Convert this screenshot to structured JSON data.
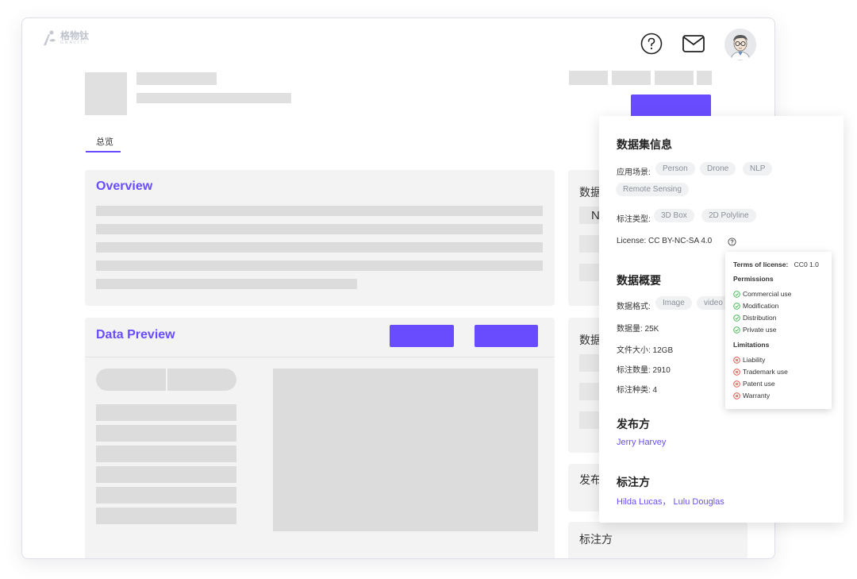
{
  "brand": {
    "name": "格物钛",
    "sub": "GRAVITI"
  },
  "tabs": [
    {
      "label": "总览"
    }
  ],
  "overview": {
    "title": "Overview"
  },
  "preview": {
    "title": "Data Preview"
  },
  "right_col": {
    "sec1": "数据",
    "letter": "N",
    "sec2": "数据",
    "sec3": "发布",
    "sec4": "标注方"
  },
  "dataset_info": {
    "title": "数据集信息",
    "scenario_label": "应用场景:",
    "scenarios": [
      "Person",
      "Drone",
      "NLP",
      "Remote Sensing"
    ],
    "annotation_label": "标注类型:",
    "annotation_types": [
      "3D Box",
      "2D Polyline"
    ],
    "license": "License: CC BY-NC-SA 4.0"
  },
  "summary": {
    "title": "数据概要",
    "format_label": "数据格式:",
    "formats": [
      "Image",
      "video"
    ],
    "count": "数据量: 25K",
    "size": "文件大小: 12GB",
    "ann_count": "标注数量: 2910",
    "ann_kinds": "标注种类: 4"
  },
  "publisher": {
    "title": "发布方",
    "name": "Jerry Harvey"
  },
  "annotator": {
    "title": "标注方",
    "names": "Hilda Lucas，  Lulu Douglas"
  },
  "license_tooltip": {
    "terms_label": "Terms of license:",
    "terms_value": "CC0 1.0",
    "permissions_title": "Permissions",
    "permissions": [
      "Commercial use",
      "Modification",
      "Distribution",
      "Private use"
    ],
    "limitations_title": "Limitations",
    "limitations": [
      "Liability",
      "Trademark use",
      "Patent use",
      "Warranty"
    ]
  },
  "colors": {
    "accent": "#6a4cff",
    "placeholder": "#e0e0e0",
    "panel": "#f3f3f3",
    "ok": "#39b54a",
    "bad": "#e8453c"
  },
  "icons": [
    "graviti-logo-icon",
    "help-icon",
    "mail-icon",
    "avatar",
    "question-circle-icon",
    "check-circle-icon",
    "x-circle-icon"
  ]
}
